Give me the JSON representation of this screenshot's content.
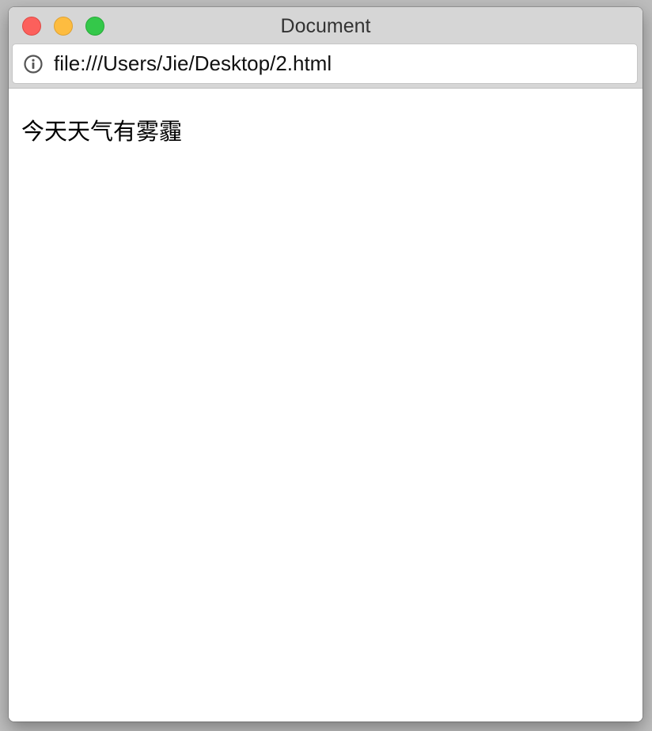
{
  "window": {
    "title": "Document"
  },
  "address_bar": {
    "url": "file:///Users/Jie/Desktop/2.html",
    "icon": "info-icon"
  },
  "page": {
    "text": "今天天气有雾霾"
  },
  "colors": {
    "close": "#fc605c",
    "minimize": "#fdbc40",
    "zoom": "#34c84a",
    "titlebar": "#d6d6d6"
  }
}
